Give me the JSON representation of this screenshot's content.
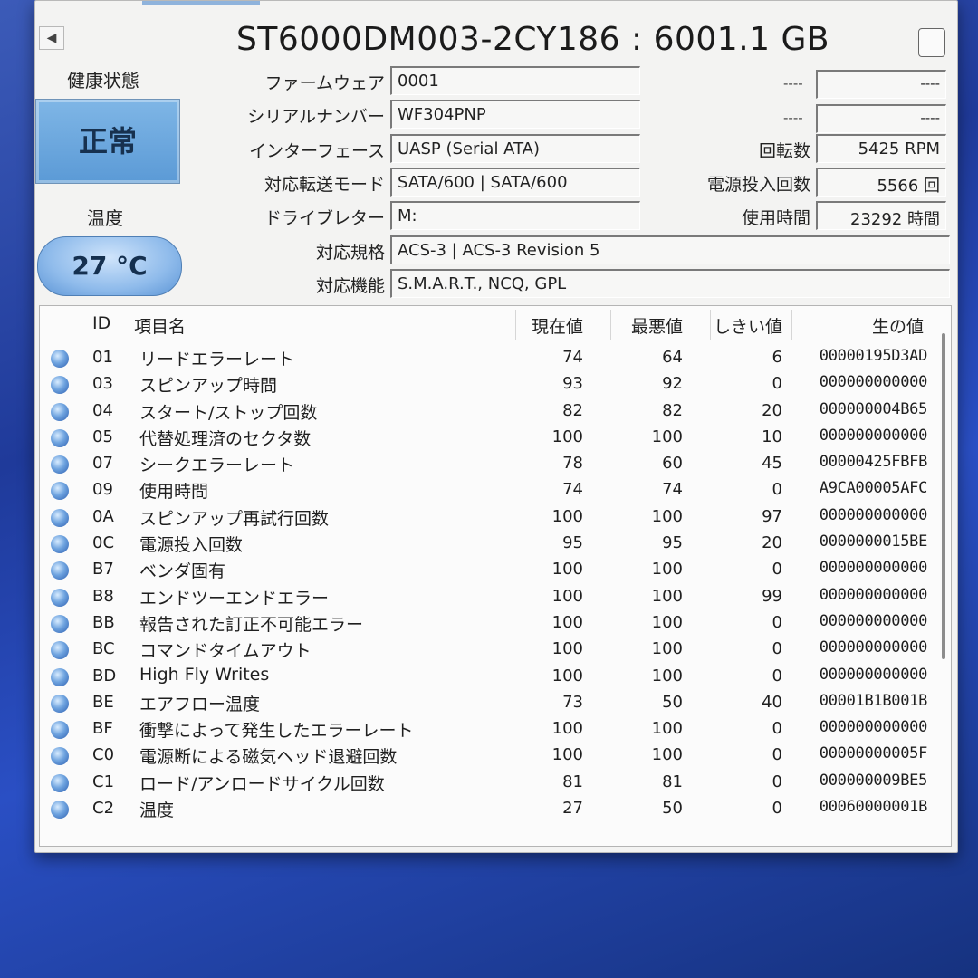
{
  "title": "ST6000DM003-2CY186 : 6001.1 GB",
  "health": {
    "label": "健康状態",
    "value": "正常"
  },
  "temperature": {
    "label": "温度",
    "value": "27 °C"
  },
  "info": [
    {
      "label": "ファームウェア",
      "value": "0001"
    },
    {
      "label": "シリアルナンバー",
      "value": "WF304PNP"
    },
    {
      "label": "インターフェース",
      "value": "UASP (Serial ATA)"
    },
    {
      "label": "対応転送モード",
      "value": "SATA/600 | SATA/600"
    },
    {
      "label": "ドライブレター",
      "value": "M:"
    },
    {
      "label": "対応規格",
      "value": "ACS-3 | ACS-3 Revision 5"
    },
    {
      "label": "対応機能",
      "value": "S.M.A.R.T., NCQ, GPL"
    }
  ],
  "right_info": [
    {
      "label": "----",
      "value": "----"
    },
    {
      "label": "----",
      "value": "----"
    },
    {
      "label": "回転数",
      "value": "5425 RPM"
    },
    {
      "label": "電源投入回数",
      "value": "5566 回"
    },
    {
      "label": "使用時間",
      "value": "23292 時間"
    }
  ],
  "table": {
    "headers": [
      "ID",
      "項目名",
      "現在値",
      "最悪値",
      "しきい値",
      "生の値"
    ],
    "rows": [
      {
        "id": "01",
        "name": "リードエラーレート",
        "cur": "74",
        "worst": "64",
        "thr": "6",
        "raw": "00000195D3AD"
      },
      {
        "id": "03",
        "name": "スピンアップ時間",
        "cur": "93",
        "worst": "92",
        "thr": "0",
        "raw": "000000000000"
      },
      {
        "id": "04",
        "name": "スタート/ストップ回数",
        "cur": "82",
        "worst": "82",
        "thr": "20",
        "raw": "000000004B65"
      },
      {
        "id": "05",
        "name": "代替処理済のセクタ数",
        "cur": "100",
        "worst": "100",
        "thr": "10",
        "raw": "000000000000"
      },
      {
        "id": "07",
        "name": "シークエラーレート",
        "cur": "78",
        "worst": "60",
        "thr": "45",
        "raw": "00000425FBFB"
      },
      {
        "id": "09",
        "name": "使用時間",
        "cur": "74",
        "worst": "74",
        "thr": "0",
        "raw": "A9CA00005AFC"
      },
      {
        "id": "0A",
        "name": "スピンアップ再試行回数",
        "cur": "100",
        "worst": "100",
        "thr": "97",
        "raw": "000000000000"
      },
      {
        "id": "0C",
        "name": "電源投入回数",
        "cur": "95",
        "worst": "95",
        "thr": "20",
        "raw": "0000000015BE"
      },
      {
        "id": "B7",
        "name": "ベンダ固有",
        "cur": "100",
        "worst": "100",
        "thr": "0",
        "raw": "000000000000"
      },
      {
        "id": "B8",
        "name": "エンドツーエンドエラー",
        "cur": "100",
        "worst": "100",
        "thr": "99",
        "raw": "000000000000"
      },
      {
        "id": "BB",
        "name": "報告された訂正不可能エラー",
        "cur": "100",
        "worst": "100",
        "thr": "0",
        "raw": "000000000000"
      },
      {
        "id": "BC",
        "name": "コマンドタイムアウト",
        "cur": "100",
        "worst": "100",
        "thr": "0",
        "raw": "000000000000"
      },
      {
        "id": "BD",
        "name": "High Fly Writes",
        "cur": "100",
        "worst": "100",
        "thr": "0",
        "raw": "000000000000"
      },
      {
        "id": "BE",
        "name": "エアフロー温度",
        "cur": "73",
        "worst": "50",
        "thr": "40",
        "raw": "00001B1B001B"
      },
      {
        "id": "BF",
        "name": "衝撃によって発生したエラーレート",
        "cur": "100",
        "worst": "100",
        "thr": "0",
        "raw": "000000000000"
      },
      {
        "id": "C0",
        "name": "電源断による磁気ヘッド退避回数",
        "cur": "100",
        "worst": "100",
        "thr": "0",
        "raw": "00000000005F"
      },
      {
        "id": "C1",
        "name": "ロード/アンロードサイクル回数",
        "cur": "81",
        "worst": "81",
        "thr": "0",
        "raw": "000000009BE5"
      },
      {
        "id": "C2",
        "name": "温度",
        "cur": "27",
        "worst": "50",
        "thr": "0",
        "raw": "00060000001B"
      }
    ]
  }
}
